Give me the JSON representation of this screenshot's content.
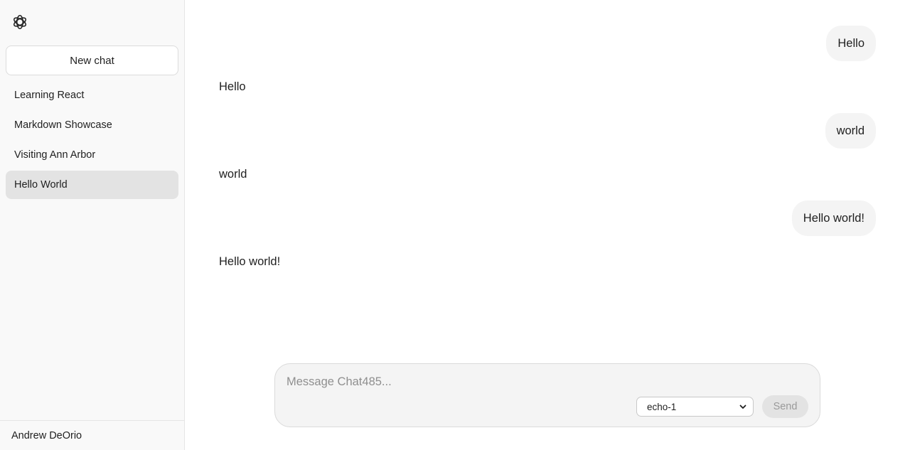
{
  "sidebar": {
    "logo_icon": "openai-logo-icon",
    "new_chat_label": "New chat",
    "chats": [
      {
        "label": "Learning React",
        "active": false
      },
      {
        "label": "Markdown Showcase",
        "active": false
      },
      {
        "label": "Visiting Ann Arbor",
        "active": false
      },
      {
        "label": "Hello World",
        "active": true
      }
    ],
    "user_name": "Andrew DeOrio"
  },
  "conversation": {
    "messages": [
      {
        "role": "user",
        "text": "Hello"
      },
      {
        "role": "assistant",
        "text": "Hello"
      },
      {
        "role": "user",
        "text": "world"
      },
      {
        "role": "assistant",
        "text": "world"
      },
      {
        "role": "user",
        "text": "Hello world!"
      },
      {
        "role": "assistant",
        "text": "Hello world!"
      }
    ]
  },
  "composer": {
    "placeholder": "Message Chat485...",
    "value": "",
    "model_selected": "echo-1",
    "send_label": "Send"
  },
  "colors": {
    "sidebar_bg": "#f9f9f9",
    "active_item_bg": "#e3e3e3",
    "bubble_bg": "#f4f4f4",
    "send_disabled_bg": "#e3e3e3"
  }
}
